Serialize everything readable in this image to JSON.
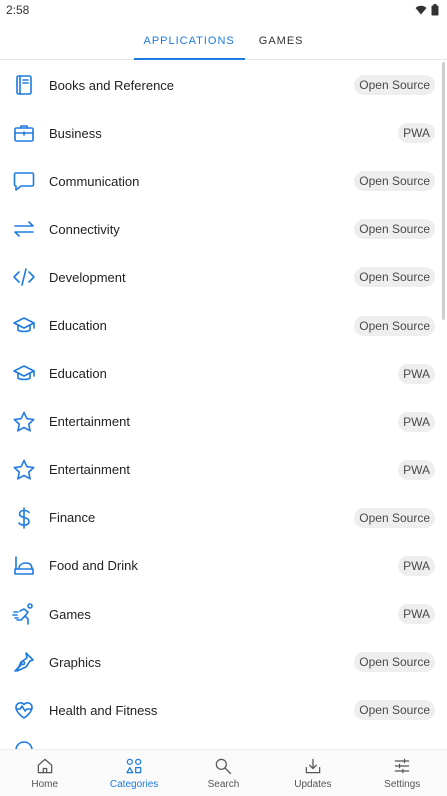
{
  "status_bar": {
    "time": "2:58",
    "icons": [
      "wifi-icon",
      "battery-icon"
    ]
  },
  "tabs": [
    {
      "label": "APPLICATIONS",
      "active": true
    },
    {
      "label": "GAMES",
      "active": false
    }
  ],
  "categories": [
    {
      "name": "Books and Reference",
      "badge": "Open Source",
      "icon": "book-icon"
    },
    {
      "name": "Business",
      "badge": "PWA",
      "icon": "briefcase-icon"
    },
    {
      "name": "Communication",
      "badge": "Open Source",
      "icon": "chat-bubble-icon"
    },
    {
      "name": "Connectivity",
      "badge": "Open Source",
      "icon": "arrows-swap-icon"
    },
    {
      "name": "Development",
      "badge": "Open Source",
      "icon": "code-icon"
    },
    {
      "name": "Education",
      "badge": "Open Source",
      "icon": "graduation-cap-icon"
    },
    {
      "name": "Education",
      "badge": "PWA",
      "icon": "graduation-cap-icon"
    },
    {
      "name": "Entertainment",
      "badge": "PWA",
      "icon": "star-icon"
    },
    {
      "name": "Entertainment",
      "badge": "PWA",
      "icon": "star-icon"
    },
    {
      "name": "Finance",
      "badge": "Open Source",
      "icon": "dollar-icon"
    },
    {
      "name": "Food and Drink",
      "badge": "PWA",
      "icon": "food-tray-icon"
    },
    {
      "name": "Games",
      "badge": "PWA",
      "icon": "running-figure-icon"
    },
    {
      "name": "Graphics",
      "badge": "Open Source",
      "icon": "pen-nib-icon"
    },
    {
      "name": "Health and Fitness",
      "badge": "Open Source",
      "icon": "heart-pulse-icon"
    }
  ],
  "bottom_nav": [
    {
      "label": "Home",
      "icon": "home-icon",
      "active": false
    },
    {
      "label": "Categories",
      "icon": "categories-icon",
      "active": true
    },
    {
      "label": "Search",
      "icon": "search-icon",
      "active": false
    },
    {
      "label": "Updates",
      "icon": "download-icon",
      "active": false
    },
    {
      "label": "Settings",
      "icon": "sliders-icon",
      "active": false
    }
  ],
  "colors": {
    "accent": "#1e7be0",
    "badge_bg": "#eeeeee"
  }
}
